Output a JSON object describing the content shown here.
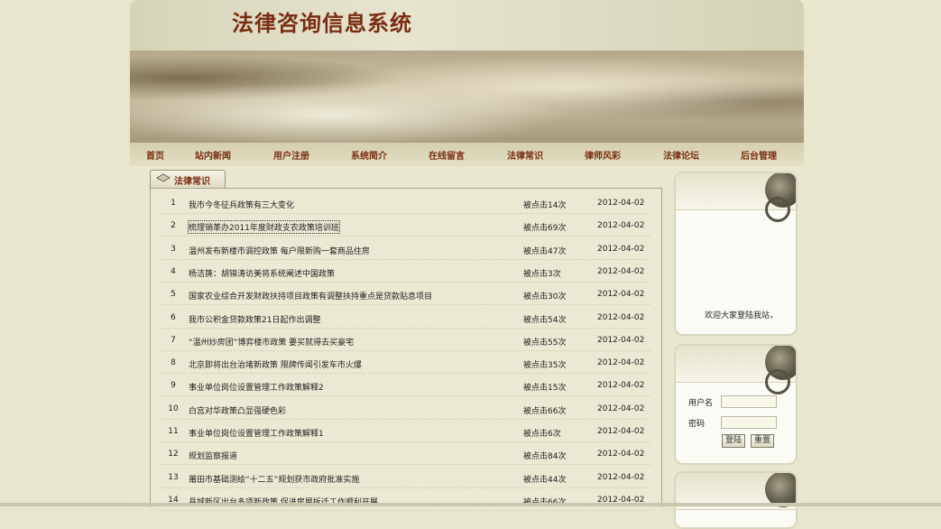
{
  "site": {
    "title": "法律咨询信息系统"
  },
  "nav": [
    "首页",
    "站内新闻",
    "用户注册",
    "系统简介",
    "在线留言",
    "法律常识",
    "律师风彩",
    "法律论坛",
    "后台管理"
  ],
  "section": {
    "tab_label": "法律常识"
  },
  "articles": [
    {
      "num": "1",
      "title": "我市今冬征兵政策有三大变化",
      "hits": "被点击14次",
      "date": "2012-04-02"
    },
    {
      "num": "2",
      "title": "梳理销革办2011年度财政支农政策培训班",
      "hits": "被点击69次",
      "date": "2012-04-02"
    },
    {
      "num": "3",
      "title": "温州发布新楼市调控政策  每户限新购一套商品住房",
      "hits": "被点击47次",
      "date": "2012-04-02"
    },
    {
      "num": "4",
      "title": "杨洁篪：胡锦涛访美将系统阐述中国政策",
      "hits": "被点击3次",
      "date": "2012-04-02"
    },
    {
      "num": "5",
      "title": "国家农业综合开发财政扶持项目政策有调整扶持重点是贷款贴息项目",
      "hits": "被点击30次",
      "date": "2012-04-02"
    },
    {
      "num": "6",
      "title": "我市公积金贷款政策21日起作出调整",
      "hits": "被点击54次",
      "date": "2012-04-02"
    },
    {
      "num": "7",
      "title": "“温州炒房团”博弈楼市政策  要买就得去买豪宅",
      "hits": "被点击55次",
      "date": "2012-04-02"
    },
    {
      "num": "8",
      "title": "北京即将出台治堵新政策  限牌传闻引发车市火爆",
      "hits": "被点击35次",
      "date": "2012-04-02"
    },
    {
      "num": "9",
      "title": "事业单位岗位设置管理工作政策解释2",
      "hits": "被点击15次",
      "date": "2012-04-02"
    },
    {
      "num": "10",
      "title": "白宫对华政策凸显强硬色彩",
      "hits": "被点击66次",
      "date": "2012-04-02"
    },
    {
      "num": "11",
      "title": "事业单位岗位设置管理工作政策解释1",
      "hits": "被点击6次",
      "date": "2012-04-02"
    },
    {
      "num": "12",
      "title": "规划监察报道",
      "hits": "被点击84次",
      "date": "2012-04-02"
    },
    {
      "num": "13",
      "title": "莆田市基础测绘“十二五”规划获市政府批准实施",
      "hits": "被点击44次",
      "date": "2012-04-02"
    },
    {
      "num": "14",
      "title": "县城新区出台多项新政策  促进房屋拆迁工作顺利开展",
      "hits": "被点击66次",
      "date": "2012-04-02"
    }
  ],
  "sidebar": {
    "welcome": "欢迎大家登陆我站，",
    "login": {
      "username_label": "用户名",
      "password_label": "密码",
      "login_button": "登陆",
      "reset_button": "重置"
    }
  },
  "colors": {
    "accent": "#7a2d12",
    "background": "#e8e6cc"
  }
}
